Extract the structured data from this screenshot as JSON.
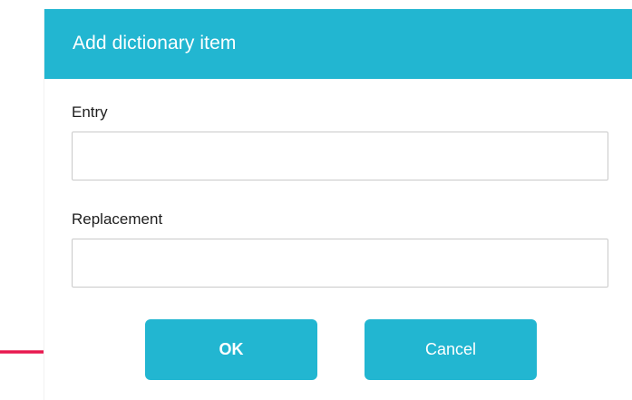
{
  "dialog": {
    "title": "Add dictionary item",
    "header_color": "#22b6d1",
    "fields": {
      "entry": {
        "label": "Entry",
        "value": "",
        "placeholder": ""
      },
      "replacement": {
        "label": "Replacement",
        "value": "",
        "placeholder": ""
      }
    },
    "buttons": {
      "ok_label": "OK",
      "cancel_label": "Cancel"
    }
  },
  "annotation": {
    "icon": "right-arrow-icon",
    "color": "#e8184f"
  }
}
